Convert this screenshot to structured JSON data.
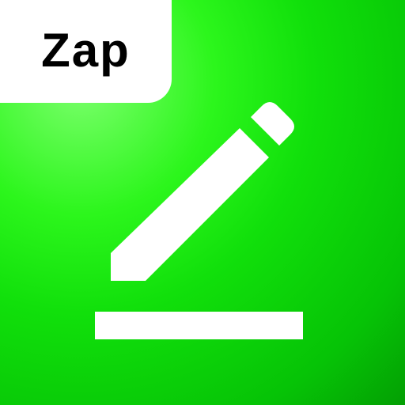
{
  "app": {
    "name": "Zap"
  },
  "icons": {
    "main": "pencil-edit-icon"
  },
  "colors": {
    "background_light": "#7dff6e",
    "background_mid": "#11e00b",
    "background_dark": "#028802",
    "foreground": "#ffffff",
    "text": "#000000"
  }
}
